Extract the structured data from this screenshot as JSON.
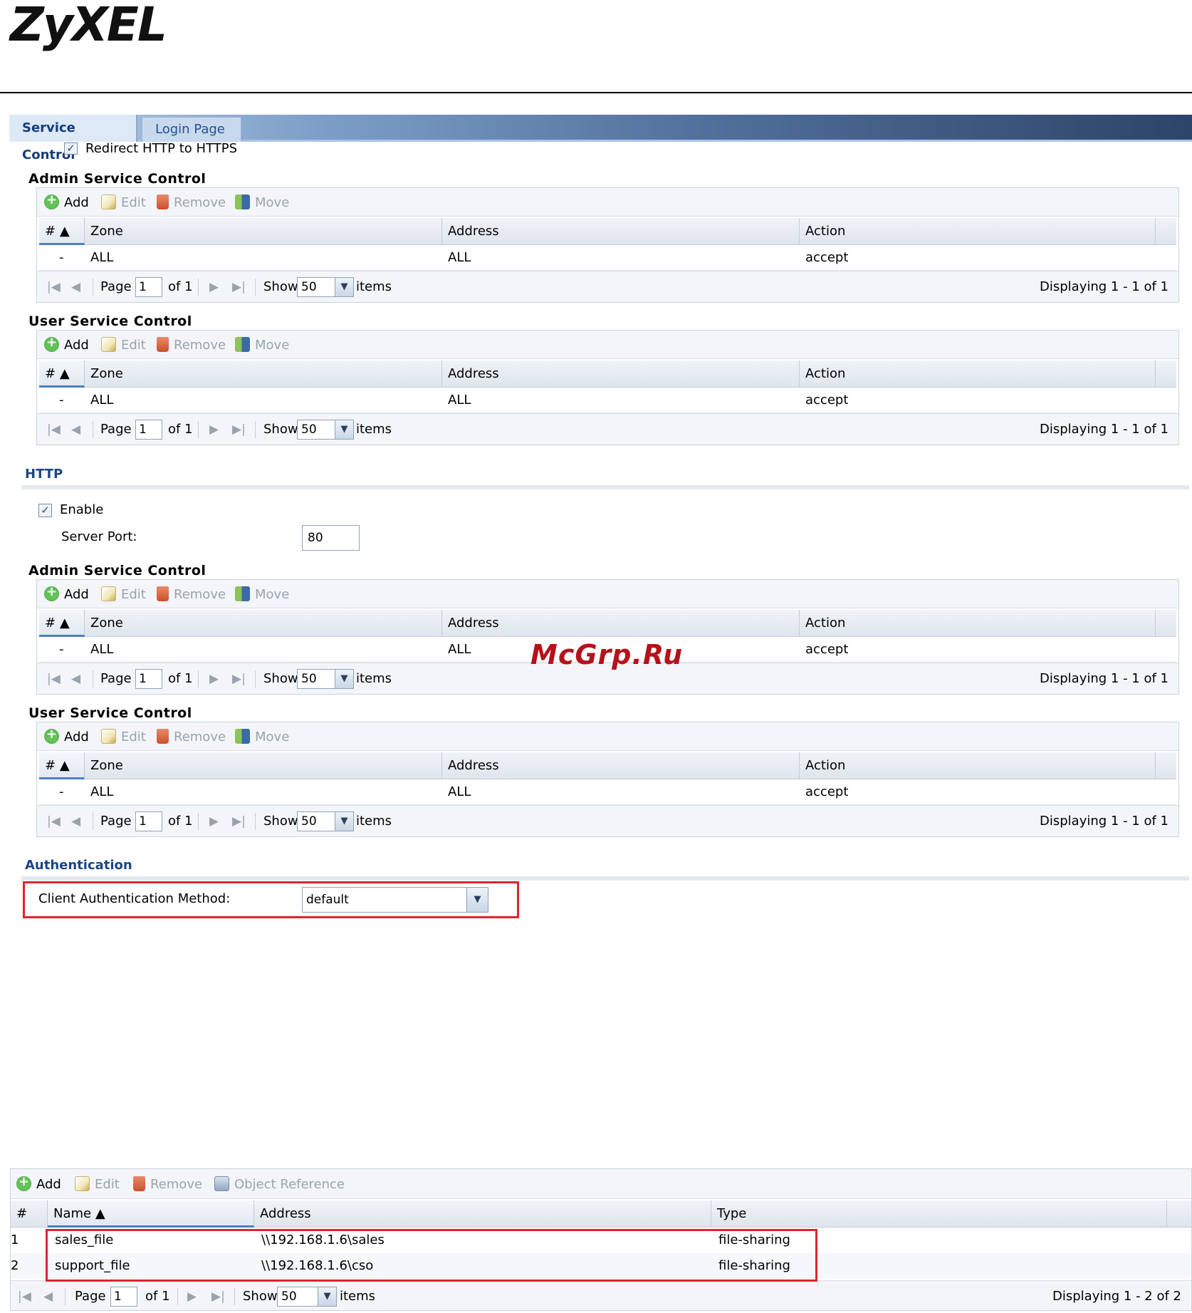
{
  "brand": "ZyXEL",
  "watermark": "McGrp.Ru",
  "tabs": [
    "Service Control",
    "Login Page"
  ],
  "https_redirect_label": "Redirect HTTP to HTTPS",
  "toolbar": {
    "add": "Add",
    "edit": "Edit",
    "remove": "Remove",
    "move": "Move"
  },
  "grid": {
    "col_hash": "#",
    "col_zone": "Zone",
    "col_address": "Address",
    "col_action": "Action",
    "row": {
      "num": "-",
      "zone": "ALL",
      "address": "ALL",
      "action": "accept"
    }
  },
  "pager": {
    "page_label": "Page",
    "page_value": "1",
    "of_label": "of 1",
    "show_label": "Show",
    "show_value": "50",
    "items_label": "items",
    "display": "Displaying 1 - 1 of 1"
  },
  "sections": {
    "admin": "Admin Service Control",
    "user": "User Service Control"
  },
  "http": {
    "title": "HTTP",
    "enable_label": "Enable",
    "enable_checked": true,
    "server_port_label": "Server Port:",
    "server_port_value": "80"
  },
  "auth": {
    "title": "Authentication",
    "method_label": "Client Authentication Method:",
    "method_value": "default"
  },
  "shares": {
    "toolbar": {
      "add": "Add",
      "edit": "Edit",
      "remove": "Remove",
      "object_reference": "Object Reference"
    },
    "columns": {
      "hash": "#",
      "name": "Name",
      "address": "Address",
      "type": "Type"
    },
    "rows": [
      {
        "num": "1",
        "name": "sales_file",
        "address": "\\\\192.168.1.6\\sales",
        "type": "file-sharing"
      },
      {
        "num": "2",
        "name": "support_file",
        "address": "\\\\192.168.1.6\\cso",
        "type": "file-sharing"
      }
    ],
    "pager": {
      "page_label": "Page",
      "page_value": "1",
      "of_label": "of 1",
      "show_label": "Show",
      "show_value": "50",
      "items_label": "items",
      "display": "Displaying 1 - 2 of 2"
    }
  }
}
